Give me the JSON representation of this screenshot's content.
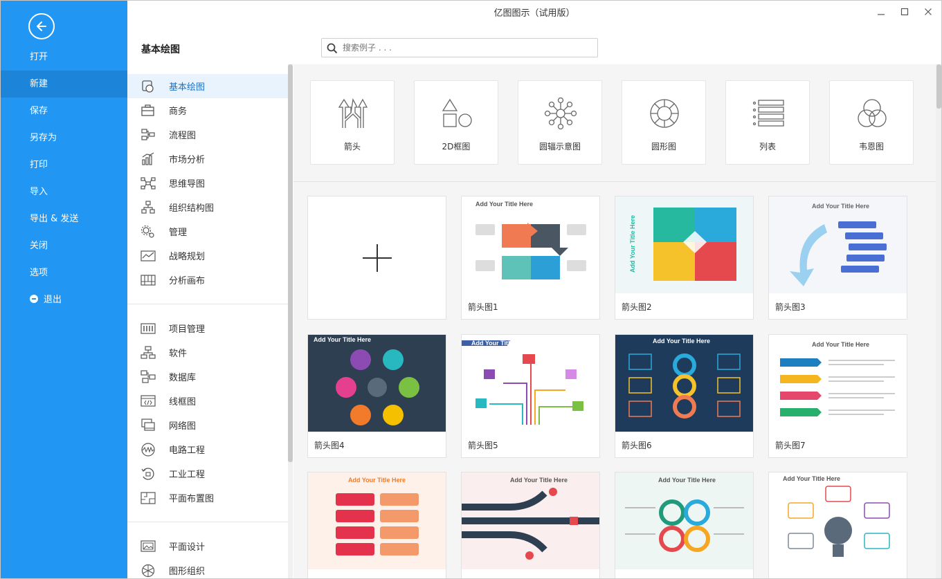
{
  "window": {
    "title": "亿图图示（试用版）",
    "controls": {
      "minimize": "—",
      "maximize": "☐",
      "close": "✕"
    }
  },
  "backstage": {
    "items": [
      {
        "label": "打开"
      },
      {
        "label": "新建"
      },
      {
        "label": "保存"
      },
      {
        "label": "另存为"
      },
      {
        "label": "打印"
      },
      {
        "label": "导入"
      },
      {
        "label": "导出 & 发送"
      },
      {
        "label": "关闭"
      },
      {
        "label": "选项"
      },
      {
        "label": "退出"
      }
    ],
    "active": "新建"
  },
  "categories": {
    "heading": "基本绘图",
    "groups": [
      [
        {
          "label": "基本绘图",
          "icon": "basic-shapes-icon"
        },
        {
          "label": "商务",
          "icon": "briefcase-icon"
        },
        {
          "label": "流程图",
          "icon": "flowchart-icon"
        },
        {
          "label": "市场分析",
          "icon": "bar-chart-icon"
        },
        {
          "label": "思维导图",
          "icon": "mindmap-icon"
        },
        {
          "label": "组织结构图",
          "icon": "org-chart-icon"
        },
        {
          "label": "管理",
          "icon": "gears-icon"
        },
        {
          "label": "战略规划",
          "icon": "strategy-icon"
        },
        {
          "label": "分析画布",
          "icon": "canvas-icon"
        }
      ],
      [
        {
          "label": "项目管理",
          "icon": "project-icon"
        },
        {
          "label": "软件",
          "icon": "software-icon"
        },
        {
          "label": "数据库",
          "icon": "database-icon"
        },
        {
          "label": "线框图",
          "icon": "wireframe-icon"
        },
        {
          "label": "网络图",
          "icon": "network-icon"
        },
        {
          "label": "电路工程",
          "icon": "circuit-icon"
        },
        {
          "label": "工业工程",
          "icon": "industrial-icon"
        },
        {
          "label": "平面布置图",
          "icon": "floorplan-icon"
        }
      ],
      [
        {
          "label": "平面设计",
          "icon": "image-icon"
        },
        {
          "label": "图形组织",
          "icon": "graphic-org-icon"
        }
      ]
    ],
    "active": "基本绘图"
  },
  "search": {
    "placeholder": "搜索例子 . . ."
  },
  "subcategories": [
    {
      "label": "箭头",
      "icon": "arrows-icon"
    },
    {
      "label": "2D框图",
      "icon": "2d-shapes-icon"
    },
    {
      "label": "圆辐示意图",
      "icon": "radial-icon"
    },
    {
      "label": "圆形图",
      "icon": "circle-diagram-icon"
    },
    {
      "label": "列表",
      "icon": "list-icon"
    },
    {
      "label": "韦恩图",
      "icon": "venn-icon"
    }
  ],
  "templates": [
    {
      "name": "",
      "type": "blank"
    },
    {
      "name": "箭头图1",
      "thumb_title": "Add Your Title Here"
    },
    {
      "name": "箭头图2",
      "thumb_title": "Add Your Title Here"
    },
    {
      "name": "箭头图3",
      "thumb_title": "Add Your Title Here"
    },
    {
      "name": "箭头图4",
      "thumb_title": "Add Your Title Here"
    },
    {
      "name": "箭头图5",
      "thumb_title": "Add Your Title Here"
    },
    {
      "name": "箭头图6",
      "thumb_title": "Add Your Title Here"
    },
    {
      "name": "箭头图7",
      "thumb_title": "Add Your Title Here"
    },
    {
      "name": "",
      "thumb_title": "Add Your Title Here"
    },
    {
      "name": "",
      "thumb_title": "Add Your Title Here"
    },
    {
      "name": "",
      "thumb_title": "Add Your Title Here"
    },
    {
      "name": "",
      "thumb_title": "Add Your Title Here"
    }
  ],
  "colors": {
    "accent": "#2196f3",
    "accent_dark": "#1c84d9",
    "active_bg": "#e8f3fd"
  }
}
